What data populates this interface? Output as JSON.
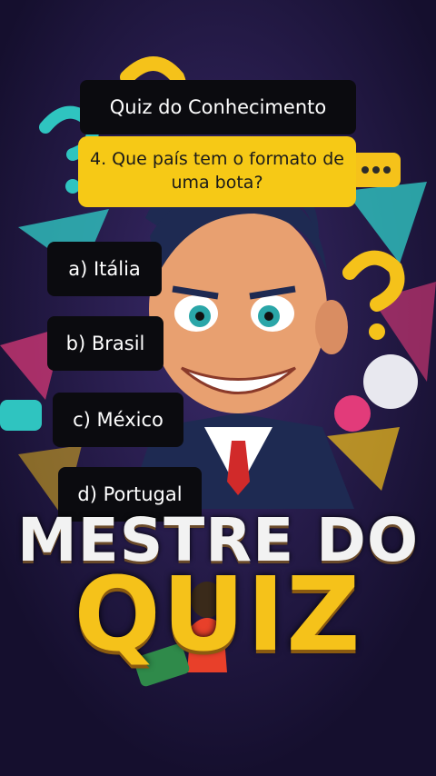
{
  "header": {
    "title": "Quiz do Conhecimento"
  },
  "question": {
    "text": "4. Que país tem o formato de uma bota?"
  },
  "answers": [
    {
      "label": "a) Itália"
    },
    {
      "label": "b) Brasil"
    },
    {
      "label": "c) México"
    },
    {
      "label": "d) Portugal"
    }
  ],
  "logo": {
    "line1": "MESTRE DO",
    "line2": "QUIZ"
  },
  "colors": {
    "background": "#1a1238",
    "question_box": "#f6c916",
    "answer_box": "#0b0b0f",
    "accent_teal": "#2fc4c0",
    "accent_pink": "#e23b7a"
  }
}
